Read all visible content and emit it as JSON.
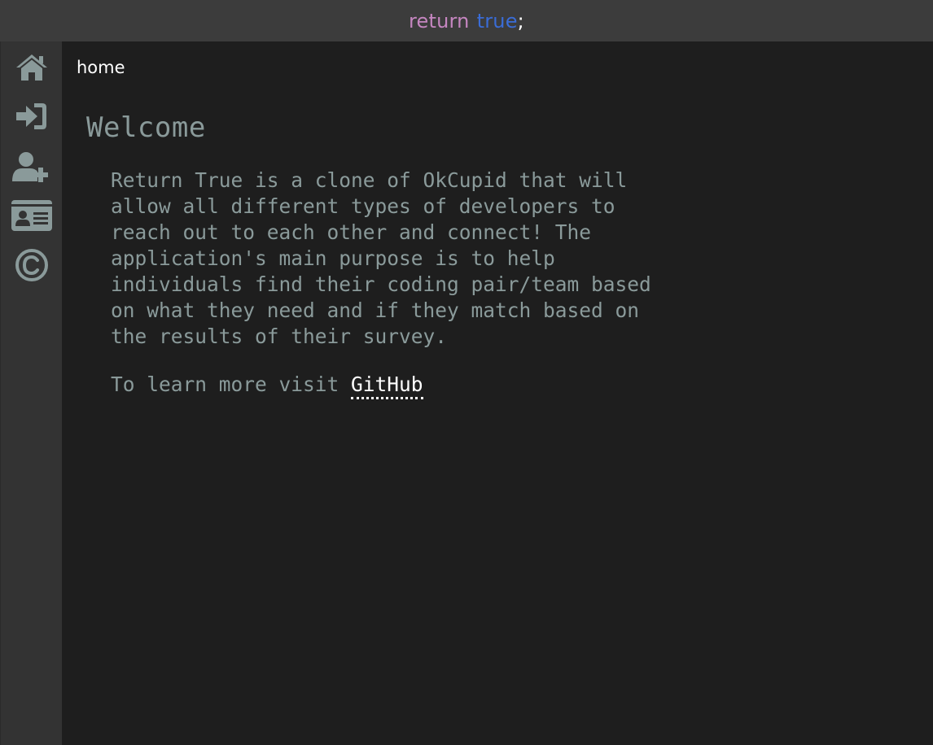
{
  "titlebar": {
    "keyword": "return",
    "value": "true",
    "semicolon": ";"
  },
  "sidebar": {
    "items": [
      {
        "icon": "home-icon",
        "label": "home"
      },
      {
        "icon": "sign-in-icon",
        "label": "login"
      },
      {
        "icon": "user-plus-icon",
        "label": "signup"
      },
      {
        "icon": "id-card-icon",
        "label": "profile"
      },
      {
        "icon": "copyright-icon",
        "label": "copyright"
      }
    ],
    "icon_color": "#8a9a9a"
  },
  "main": {
    "tab_label": "home",
    "heading": "Welcome",
    "paragraph": "Return True is a clone of OkCupid that will\nallow all different types of developers to\nreach out to each other and connect! The\napplication's main purpose is to help\nindividuals find their coding pair/team based\non what they need and if they match based on\nthe results of their survey.",
    "learn_more_prefix": "To learn more visit ",
    "learn_more_link": "GitHub"
  },
  "colors": {
    "titlebar_bg": "#3c3c3c",
    "sidebar_bg": "#333333",
    "main_bg": "#1e1e1e",
    "text": "#8a9a9a",
    "keyword": "#c586c0",
    "boolean": "#3a6cd6"
  }
}
